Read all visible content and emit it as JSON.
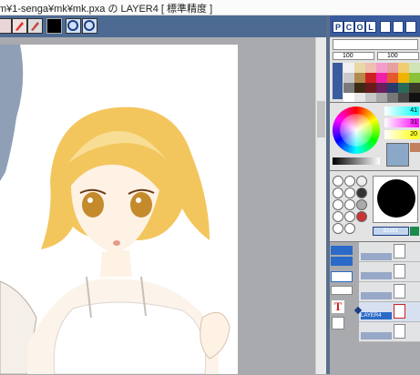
{
  "window": {
    "title": "m¥1-senga¥mk¥mk.pxa の LAYER4 [ 標準精度 ]"
  },
  "panel": {
    "tabs": [
      "P",
      "C",
      "O",
      "L"
    ],
    "brush_size_top": "100",
    "brush_size_right": "100",
    "rgb": {
      "r": "41",
      "g": "31",
      "b": "20"
    },
    "brush_label": "81x81",
    "layer_selected_name": "LAYER4"
  },
  "colors": {
    "accent": "#1d3d84",
    "toolbar": "#4d6a93",
    "panel_bg": "#a9aaad"
  }
}
